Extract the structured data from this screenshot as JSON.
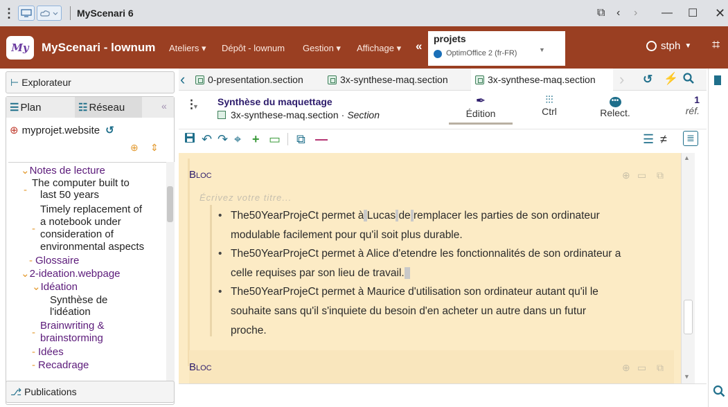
{
  "window": {
    "title": "MyScenari 6"
  },
  "appbar": {
    "brand": "MyScenari - lownum",
    "menu": [
      "Ateliers ▾",
      "Dépôt - lownum",
      "Gestion ▾",
      "Affichage ▾"
    ],
    "collapse": "«",
    "project_title": "projets",
    "project_sub": "OptimOffice 2 (fr-FR)",
    "user": "stph"
  },
  "left": {
    "explorer": "Explorateur",
    "tab_plan": "Plan",
    "tab_reseau": "Réseau",
    "tab_collapse": "«",
    "root": "myprojet.website",
    "tree": [
      "Notes de lecture",
      "The computer built to",
      "last 50 years",
      "Timely replacement of",
      "a notebook under",
      "consideration of",
      "environmental aspects",
      "Glossaire",
      "2-ideation.webpage",
      "Idéation",
      "Synthèse de",
      "l'idéation",
      "Brainwriting &",
      "brainstorming",
      "Idées",
      "Recadrage"
    ],
    "publications": "Publications"
  },
  "tabs": [
    "0-presentation.section",
    "3x-synthese-maq.section",
    "3x-synthese-maq.section"
  ],
  "doc": {
    "title": "Synthèse du maquettage",
    "file": "3x-synthese-maq.section",
    "type": "Section",
    "views": [
      "Édition",
      "Ctrl",
      "Relect."
    ],
    "refs_count": "1",
    "refs_label": "réf."
  },
  "editor": {
    "bloc_label": "Bloc",
    "title_placeholder": "Écrivez votre titre...",
    "b1a": "The50YearProjeCt permet à",
    "b1_name": "Lucas",
    "b1b": "de",
    "b1c": "remplacer les parties de son ordinateur",
    "b1d": "modulable facilement pour qu'il soit plus durable.",
    "b2a": "The50YearProjeCt permet à Alice d'etendre les fonctionnalités de son ordinateur a",
    "b2b": "celle requises par son lieu de travail.",
    "b3a": "The50YearProjeCt permet à Maurice d'utilisation son ordinateur autant qu'il le",
    "b3b": "souhaite sans qu'il s'inquiete du besoin d'en acheter un autre dans un futur",
    "b3c": "proche."
  },
  "colors": {
    "appbar": "#9a3f22",
    "editor_bg": "#fcebc5",
    "accent": "#1f6f8b",
    "tree_text": "#5b1a7a"
  }
}
